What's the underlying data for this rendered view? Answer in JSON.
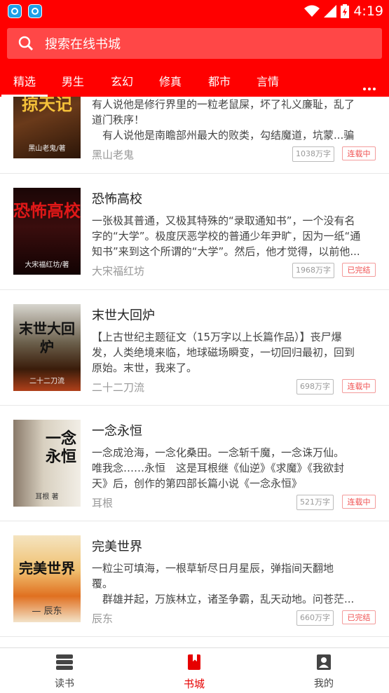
{
  "status_bar": {
    "time": "4:19"
  },
  "search": {
    "placeholder": "搜索在线书城"
  },
  "tabs": [
    "精选",
    "男生",
    "玄幻",
    "修真",
    "都市",
    "言情"
  ],
  "books": [
    {
      "title": "",
      "desc_lines": [
        "有人说他是修行界里的一粒老鼠屎，坏了礼义廉耻，乱了",
        "道门秩序！",
        "　有人说他是南瞻部州最大的败类，勾结魔道，坑蒙...骗"
      ],
      "author": "黑山老鬼",
      "words": "1038万字",
      "status": "连载中",
      "cover_title": "掠天记",
      "cover_author": "黑山老鬼/著"
    },
    {
      "title": "恐怖高校",
      "desc_lines": [
        "一张极其普通，又极其特殊的“录取通知书”，一个没有名",
        "字的“大学”。极度厌恶学校的普通少年尹旷，因为一纸“通",
        "知书”来到这个所谓的“大学”。然后，他才觉得，以前他..."
      ],
      "author": "大宋福红坊",
      "words": "1968万字",
      "status": "已完结",
      "cover_title": "恐怖高校",
      "cover_author": "大宋福红坊/著"
    },
    {
      "title": "末世大回炉",
      "desc_lines": [
        "【上古世纪主题征文（15万字以上长篇作品）】丧尸爆",
        "发，人类绝境来临，地球磁场瞬变，一切回归最初，回到",
        "原始。末世，我来了。"
      ],
      "author": "二十二刀流",
      "words": "698万字",
      "status": "连载中",
      "cover_title": "末世大回炉",
      "cover_author": "二十二刀流"
    },
    {
      "title": "一念永恒",
      "desc_lines": [
        "一念成沧海，一念化桑田。一念斩千魔，一念诛万仙。",
        "唯我念……永恒　这是耳根继《仙逆》《求魔》《我欲封",
        "天》后，创作的第四部长篇小说《一念永恒》"
      ],
      "author": "耳根",
      "words": "521万字",
      "status": "连载中",
      "cover_title": "一念永恒",
      "cover_author": "耳根 著"
    },
    {
      "title": "完美世界",
      "desc_lines": [
        "一粒尘可填海，一根草斩尽日月星辰，弹指间天翻地",
        "覆。",
        "　群雄并起，万族林立，诸圣争霸，乱天动地。问苍茫..."
      ],
      "author": "辰东",
      "words": "660万字",
      "status": "已完结",
      "cover_title": "完美世界",
      "cover_author": "— 辰东"
    }
  ],
  "bottom_nav": [
    {
      "label": "读书",
      "icon": "bookshelf-icon"
    },
    {
      "label": "书城",
      "icon": "bookmark-icon"
    },
    {
      "label": "我的",
      "icon": "profile-icon"
    }
  ],
  "colors": {
    "brand": "#ff0000",
    "active": "#e60000"
  }
}
